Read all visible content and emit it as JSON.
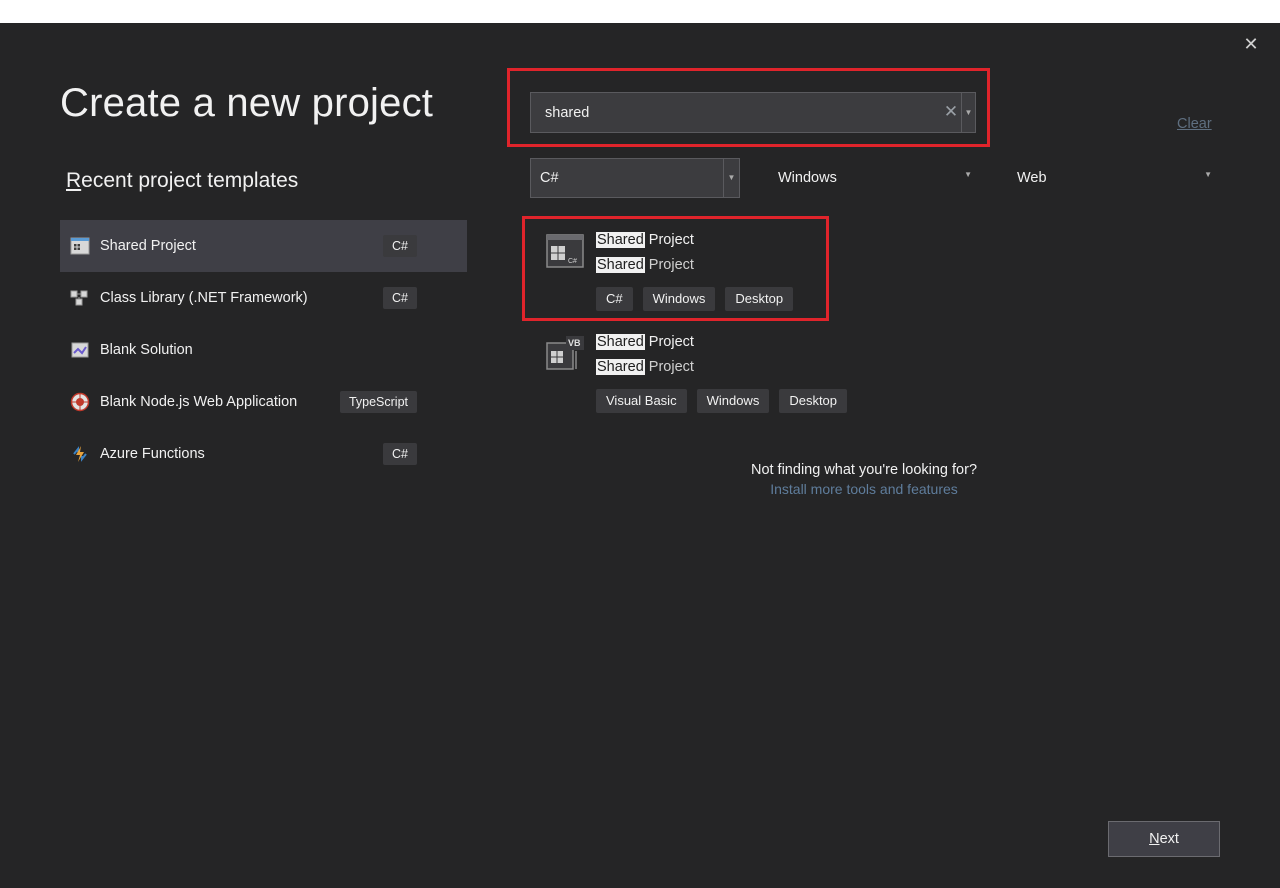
{
  "dialog": {
    "title": "Create a new project",
    "close_glyph": "✕"
  },
  "recent": {
    "title_prefix": "R",
    "title_rest": "ecent project templates",
    "items": [
      {
        "label": "Shared Project",
        "tag": "C#",
        "icon": "shared-project-icon",
        "selected": true
      },
      {
        "label": "Class Library (.NET Framework)",
        "tag": "C#",
        "icon": "class-library-icon"
      },
      {
        "label": "Blank Solution",
        "tag": "",
        "icon": "blank-solution-icon"
      },
      {
        "label": "Blank Node.js Web Application",
        "tag": "TypeScript",
        "icon": "nodejs-icon"
      },
      {
        "label": "Azure Functions",
        "tag": "C#",
        "icon": "azure-functions-icon"
      }
    ]
  },
  "search": {
    "value": "shared",
    "clear_glyph": "✕",
    "clear_all_label_prefix": "C",
    "clear_all_label_rest": "lear"
  },
  "filters": {
    "language": "C#",
    "platform": "Windows",
    "project_type": "Web"
  },
  "results": [
    {
      "match": "Shared",
      "name_rest": " Project",
      "desc_match": "Shared",
      "desc_rest": " Project",
      "tags": [
        "C#",
        "Windows",
        "Desktop"
      ],
      "icon": "csharp-shared-project-icon"
    },
    {
      "match": "Shared",
      "name_rest": " Project",
      "desc_match": "Shared",
      "desc_rest": " Project",
      "tags": [
        "Visual Basic",
        "Windows",
        "Desktop"
      ],
      "icon": "vb-shared-project-icon"
    }
  ],
  "help": {
    "question": "Not finding what you're looking for?",
    "link": "Install more tools and features"
  },
  "footer": {
    "next_prefix": "N",
    "next_rest": "ext"
  },
  "colors": {
    "background": "#252526",
    "highlight_border": "#e0242b",
    "selected_row": "#3f3f46"
  }
}
